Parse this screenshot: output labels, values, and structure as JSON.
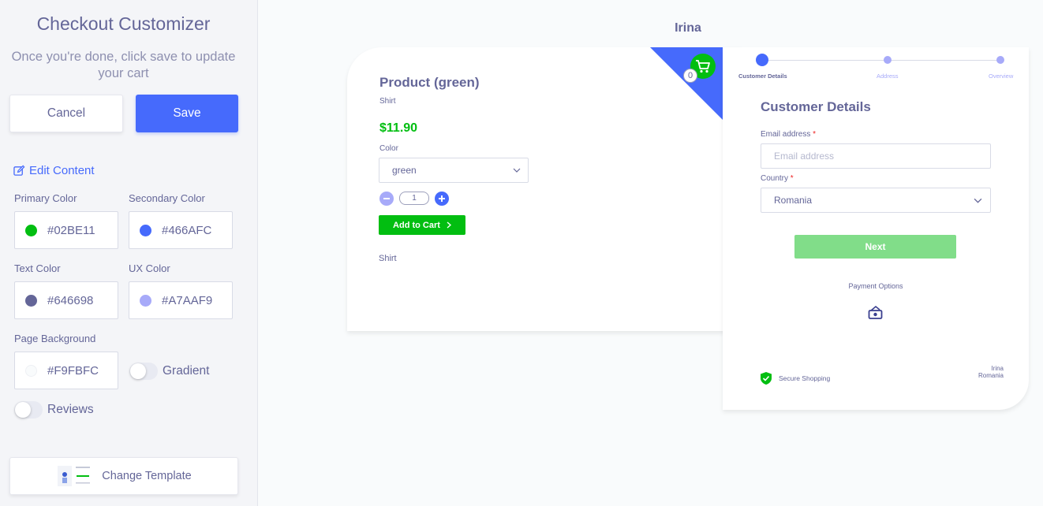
{
  "sidebar": {
    "title": "Checkout Customizer",
    "subtitle": "Once you're done, click save to update your cart",
    "cancel_label": "Cancel",
    "save_label": "Save",
    "edit_content_label": "Edit Content",
    "colors": {
      "primary": {
        "label": "Primary Color",
        "value": "#02BE11"
      },
      "secondary": {
        "label": "Secondary Color",
        "value": "#466AFC"
      },
      "text": {
        "label": "Text Color",
        "value": "#646698"
      },
      "ux": {
        "label": "UX Color",
        "value": "#A7AAF9"
      },
      "background": {
        "label": "Page Background",
        "value": "#F9FBFC"
      }
    },
    "gradient_label": "Gradient",
    "gradient_on": false,
    "reviews_label": "Reviews",
    "reviews_on": false,
    "change_template_label": "Change Template"
  },
  "preview": {
    "store_name": "Irina",
    "product": {
      "name": "Product (green)",
      "type": "Shirt",
      "price": "$11.90",
      "color_label": "Color",
      "color_value": "green",
      "quantity": "1",
      "add_to_cart_label": "Add to Cart",
      "description": "Shirt",
      "cart_count": "0"
    },
    "checkout": {
      "steps": [
        {
          "label": "Customer Details",
          "active": true
        },
        {
          "label": "Address",
          "active": false
        },
        {
          "label": "Overview",
          "active": false
        }
      ],
      "title": "Customer Details",
      "email_label": "Email address",
      "email_placeholder": "Email address",
      "country_label": "Country",
      "country_value": "Romania",
      "required_mark": "*",
      "next_label": "Next",
      "payment_options_label": "Payment Options",
      "secure_label": "Secure Shopping",
      "address_name": "Irina",
      "address_country": "Romania"
    }
  }
}
